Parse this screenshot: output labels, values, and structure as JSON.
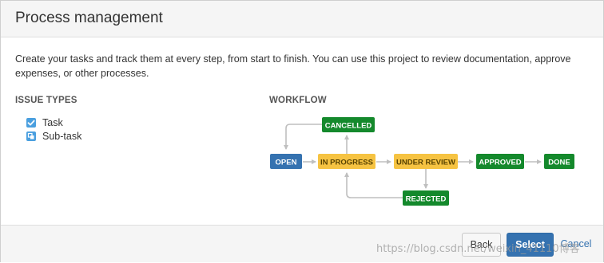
{
  "dialog": {
    "title": "Process management",
    "description": "Create your tasks and track them at every step, from start to finish. You can use this project to review documentation, approve expenses, or other processes."
  },
  "issue_types": {
    "heading": "ISSUE TYPES",
    "items": [
      {
        "label": "Task",
        "icon": "task-checkbox-icon"
      },
      {
        "label": "Sub-task",
        "icon": "subtask-icon"
      }
    ]
  },
  "workflow": {
    "heading": "WORKFLOW",
    "states": {
      "open": "OPEN",
      "in_progress": "IN PROGRESS",
      "under_review": "UNDER REVIEW",
      "approved": "APPROVED",
      "done": "DONE",
      "cancelled": "CANCELLED",
      "rejected": "REJECTED"
    },
    "colors": {
      "blue": "#3572b0",
      "yellow": "#f6c342",
      "green": "#14892c",
      "arrow": "#bfbfbf"
    }
  },
  "footer": {
    "back_label": "Back",
    "select_label": "Select",
    "cancel_label": "Cancel",
    "watermark": "https://blog.csdn.net/weixin_41110博客"
  }
}
